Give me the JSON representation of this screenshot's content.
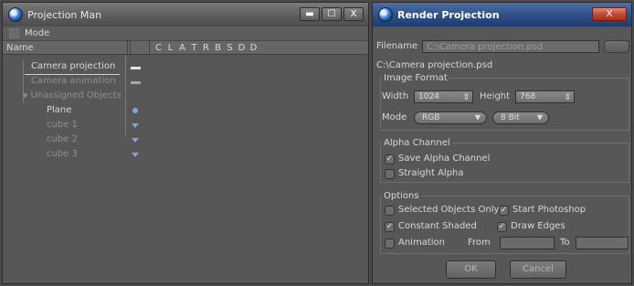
{
  "projection_manager": {
    "title": "Projection Man",
    "menu": {
      "mode_label": "Mode"
    },
    "columns": {
      "name_label": "Name",
      "letters": [
        "C",
        "L",
        "A",
        "T",
        "R",
        "B",
        "S",
        "D",
        "D"
      ]
    },
    "items": [
      {
        "label": "Camera projection",
        "state": "active"
      },
      {
        "label": "Camera animation",
        "state": "dim"
      }
    ],
    "group": {
      "label": "Unassigned Objects"
    },
    "objects": [
      {
        "label": "Plane",
        "icon": "circle"
      },
      {
        "label": "cube 1",
        "icon": "triangle"
      },
      {
        "label": "cube 2",
        "icon": "triangle"
      },
      {
        "label": "cube 3",
        "icon": "triangle"
      }
    ],
    "window_buttons": {
      "minimize": "▬",
      "maximize": "☐",
      "close": "X"
    }
  },
  "render_projection": {
    "title": "Render Projection",
    "filename_label": "Filename",
    "filename_value": "C:\\Camera  projection.psd",
    "path_text": "C:\\Camera  projection.psd",
    "image_format": {
      "title": "Image Format",
      "width_label": "Width",
      "width_value": "1024",
      "height_label": "Height",
      "height_value": "768",
      "mode_label": "Mode",
      "mode_value": "RGB",
      "bits_value": "8 Bit"
    },
    "alpha": {
      "title": "Alpha Channel",
      "save_alpha": {
        "label": "Save Alpha Channel",
        "checked": true
      },
      "straight_alpha": {
        "label": "Straight Alpha",
        "checked": false
      }
    },
    "options": {
      "title": "Options",
      "selected_only": {
        "label": "Selected Objects Only",
        "checked": false
      },
      "start_photoshop": {
        "label": "Start Photoshop",
        "checked": true
      },
      "constant_shaded": {
        "label": "Constant Shaded",
        "checked": true
      },
      "draw_edges": {
        "label": "Draw Edges",
        "checked": true
      },
      "animation": {
        "label": "Animation",
        "checked": false
      },
      "from_label": "From",
      "to_label": "To"
    },
    "buttons": {
      "ok": "OK",
      "cancel": "Cancel",
      "close": "X"
    }
  }
}
